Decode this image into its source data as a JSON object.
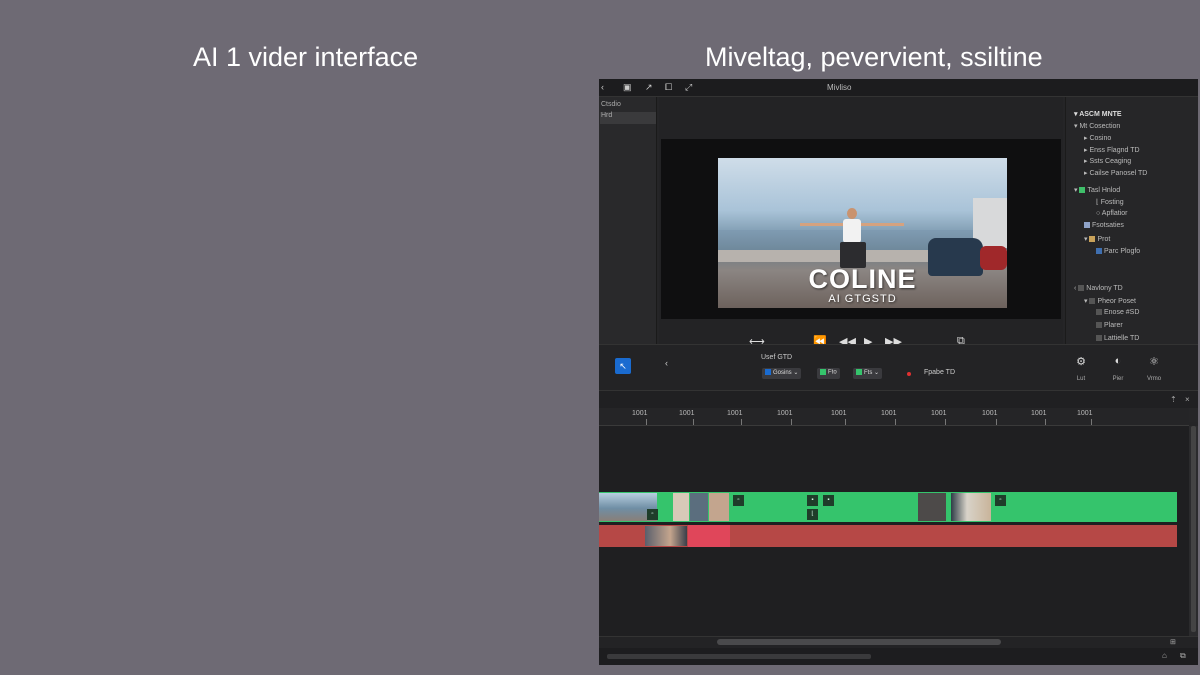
{
  "headings": {
    "left": "AI 1 vider interface",
    "right": "Miveltag, pevervient, ssiltine"
  },
  "titlebar": {
    "title": "Mivliso",
    "icons": [
      "chevron-left-icon",
      "panel-icon",
      "arrow-icon",
      "crop-icon",
      "expand-icon"
    ]
  },
  "leftnav": {
    "items": [
      {
        "label": "Ctsdio",
        "selected": false
      },
      {
        "label": "Hrd",
        "selected": true
      }
    ]
  },
  "viewer": {
    "overlay_title": "COLINE",
    "overlay_subtitle": "AI GTGSTD",
    "transport": {
      "rewind": "⟷",
      "prev": "⏪",
      "step_back": "◀◀",
      "play": "▶",
      "step_fwd": "▶▶",
      "screen": "⧉"
    }
  },
  "properties": {
    "header": "ASCM MNTE",
    "items": [
      {
        "label": "Mt Cosection",
        "indent": 0,
        "marker": "▾"
      },
      {
        "label": "Cosino",
        "indent": 1,
        "marker": "▸"
      },
      {
        "label": "Enss Flagnd TD",
        "indent": 1,
        "marker": "▸"
      },
      {
        "label": "Ssts Ceaging",
        "indent": 1,
        "marker": "▸"
      },
      {
        "label": "Cailse Panosel TD",
        "indent": 1,
        "marker": "▸"
      },
      {
        "label": "Tasl Hnlod",
        "indent": 0,
        "marker": "▾",
        "swatch": "#3fbf6a"
      },
      {
        "label": "Fosting",
        "indent": 2,
        "marker": "⌊"
      },
      {
        "label": "Apflatior",
        "indent": 2,
        "marker": "○"
      },
      {
        "label": "Fsotsaties",
        "indent": 1,
        "marker": "",
        "swatch": "#8fa3c8"
      },
      {
        "label": "Prot",
        "indent": 1,
        "marker": "▾",
        "swatch": "#c9a25a"
      },
      {
        "label": "Parc Plogfo",
        "indent": 2,
        "marker": "",
        "swatch": "#3f6fb0"
      },
      {
        "label": "Navlony TD",
        "indent": 0,
        "marker": "‹",
        "swatch": "#555"
      },
      {
        "label": "Pheor Poset",
        "indent": 1,
        "marker": "▾",
        "swatch": "#555"
      },
      {
        "label": "Enose #SD",
        "indent": 2,
        "marker": "",
        "swatch": "#555"
      },
      {
        "label": "Plarer",
        "indent": 2,
        "marker": "",
        "swatch": "#555"
      },
      {
        "label": "Lattielle TD",
        "indent": 2,
        "marker": "",
        "swatch": "#555"
      }
    ]
  },
  "controls": {
    "section_label": "Usef GTD",
    "chips": [
      {
        "label": "Gosins ⌄",
        "color": "#1a6bd0"
      },
      {
        "label": "Fto",
        "color": "#35c46c"
      },
      {
        "label": "Fts ⌄",
        "color": "#35c46c"
      }
    ],
    "right_label": "Fpabe TD",
    "tools": [
      {
        "icon": "⚙",
        "label": "Lut"
      },
      {
        "icon": "◐",
        "label": "Pier"
      },
      {
        "icon": "⚛",
        "label": "Vrmo"
      }
    ]
  },
  "ruler": {
    "ticks": [
      "1001",
      "1001",
      "1001",
      "1001",
      "1001",
      "1001",
      "1001",
      "1001",
      "1001",
      "1001"
    ]
  },
  "colors": {
    "accent_blue": "#1a6bd0",
    "track_green": "#35c46c",
    "track_red": "#b64846",
    "scrub_line": "#5a5ac8"
  }
}
